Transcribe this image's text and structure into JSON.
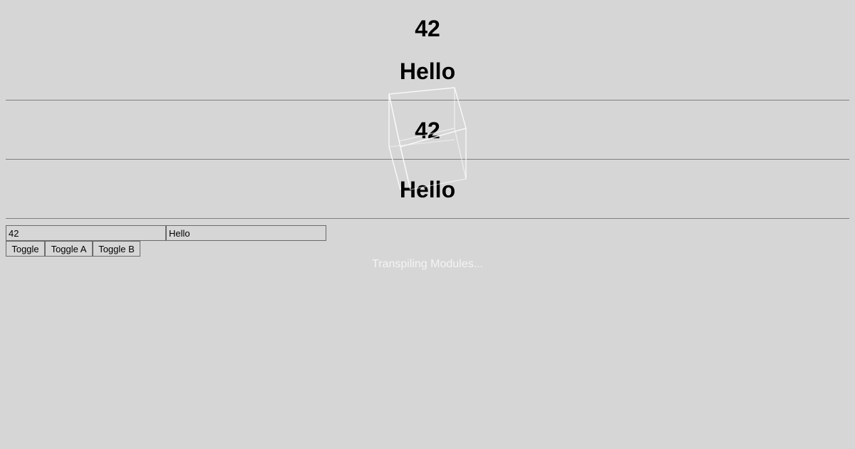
{
  "views": {
    "first": {
      "count": "42",
      "greeting": "Hello"
    },
    "second": {
      "count": "42",
      "greeting": "Hello"
    }
  },
  "inputs": {
    "count_value": "42",
    "greeting_value": "Hello"
  },
  "buttons": {
    "toggle": "Toggle",
    "toggle_a": "Toggle A",
    "toggle_b": "Toggle B"
  },
  "loading": {
    "text": "Transpiling Modules...",
    "icon": "cube-icon"
  },
  "colors": {
    "background": "#d6d6d6",
    "loading_text": "#f4f4f4"
  }
}
